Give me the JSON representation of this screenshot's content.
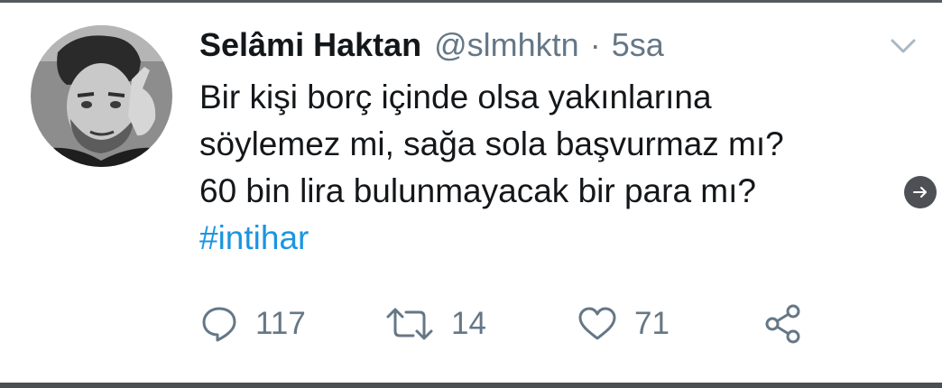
{
  "tweet": {
    "author": {
      "display_name": "Selâmi Haktan",
      "handle": "@slmhktn",
      "avatar_icon": "avatar-photo"
    },
    "separator": "·",
    "time": "5sa",
    "text_lines": [
      "Bir kişi borç içinde olsa yakınlarına",
      "söylemez mi, sağa sola başvurmaz mı?",
      "60 bin lira bulunmayacak bir para mı?"
    ],
    "hashtag": "#intihar",
    "actions": {
      "reply": {
        "icon": "reply-icon",
        "count": "117"
      },
      "retweet": {
        "icon": "retweet-icon",
        "count": "14"
      },
      "like": {
        "icon": "heart-icon",
        "count": "71"
      },
      "share": {
        "icon": "share-icon"
      }
    },
    "menu_icon": "chevron-down-icon",
    "side_button_icon": "arrow-right-icon"
  },
  "colors": {
    "text_primary": "#14171a",
    "text_secondary": "#657786",
    "hashtag": "#1b95e0",
    "border": "#4a4f55"
  }
}
